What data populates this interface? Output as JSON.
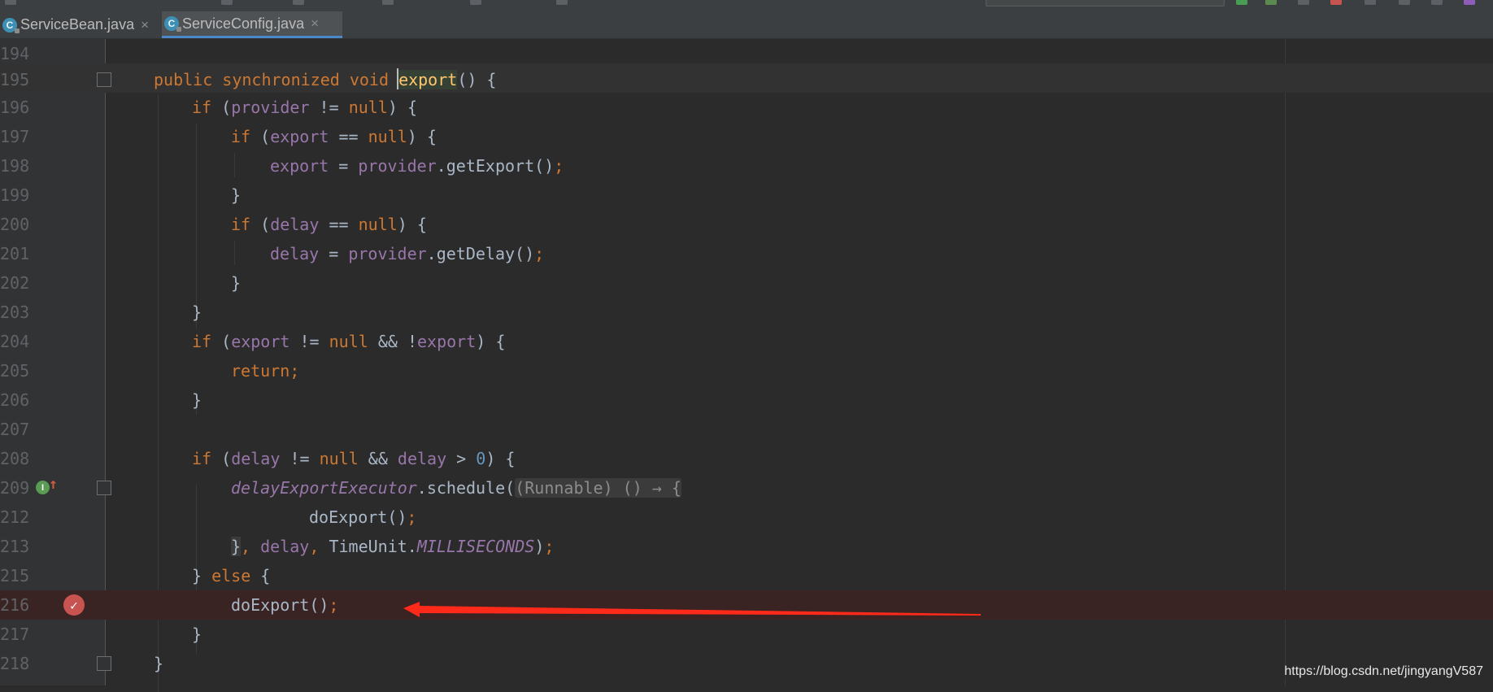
{
  "tabs": [
    {
      "label": "ServiceBean.java",
      "icon": "java-class-icon",
      "active": false
    },
    {
      "label": "ServiceConfig.java",
      "icon": "java-class-icon",
      "active": true
    }
  ],
  "tab_close_glyph": "×",
  "editor": {
    "lines": [
      {
        "num": "194"
      },
      {
        "num": "195"
      },
      {
        "num": "196"
      },
      {
        "num": "197"
      },
      {
        "num": "198"
      },
      {
        "num": "199"
      },
      {
        "num": "200"
      },
      {
        "num": "201"
      },
      {
        "num": "202"
      },
      {
        "num": "203"
      },
      {
        "num": "204"
      },
      {
        "num": "205"
      },
      {
        "num": "206"
      },
      {
        "num": "207"
      },
      {
        "num": "208"
      },
      {
        "num": "209"
      },
      {
        "num": "212"
      },
      {
        "num": "213"
      },
      {
        "num": "215"
      },
      {
        "num": "216"
      },
      {
        "num": "217"
      },
      {
        "num": "218"
      }
    ],
    "tokens": {
      "kw_public": "public",
      "kw_synchronized": "synchronized",
      "kw_void": "void",
      "kw_if": "if",
      "kw_null": "null",
      "kw_return": "return",
      "kw_else": "else",
      "method_export": "export",
      "field_provider": "provider",
      "field_export": "export",
      "field_delay": "delay",
      "call_getExport": "getExport",
      "call_getDelay": "getDelay",
      "static_executor": "delayExportExecutor",
      "call_schedule": "schedule",
      "hint_lambda": "(Runnable) () → {",
      "call_doExport": "doExport",
      "class_timeunit": "TimeUnit",
      "const_ms": "MILLISECONDS",
      "num_zero": "0"
    },
    "breakpoint_line": "216",
    "current_line": "195",
    "colors": {
      "background": "#2b2b2b",
      "gutter": "#313335",
      "keyword": "#cc7832",
      "field": "#9876aa",
      "text": "#a9b7c6",
      "number": "#6897bb",
      "line_number": "#606366",
      "breakpoint": "#c75450",
      "annotation_arrow": "#ff2a1a"
    }
  },
  "watermark": "https://blog.csdn.net/jingyangV587"
}
